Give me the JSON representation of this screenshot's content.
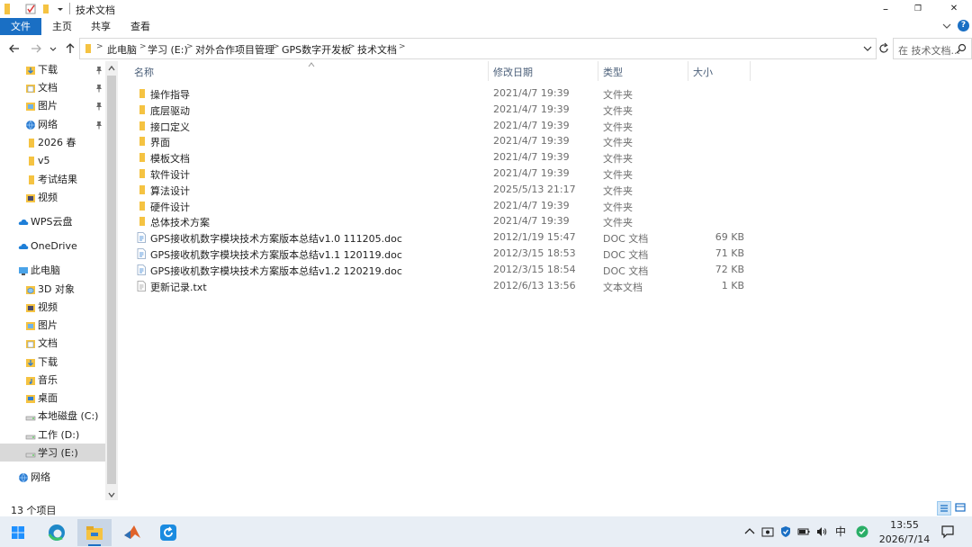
{
  "window": {
    "title": "技术文档",
    "minimize_label": "–",
    "maximize_label": "❐",
    "close_label": "✕"
  },
  "ribbon": {
    "tabs": [
      "文件",
      "主页",
      "共享",
      "查看"
    ],
    "help_label": "?"
  },
  "address": {
    "breadcrumbs": [
      "此电脑",
      "学习 (E:)",
      "对外合作项目管理",
      "GPS数字开发板",
      "技术文档"
    ],
    "search_placeholder": "在 技术文档..."
  },
  "nav": {
    "items": [
      {
        "label": "下载",
        "icon": "download-folder-icon",
        "pinned": true
      },
      {
        "label": "文档",
        "icon": "documents-folder-icon",
        "pinned": true
      },
      {
        "label": "图片",
        "icon": "pictures-folder-icon",
        "pinned": true
      },
      {
        "label": "网络",
        "icon": "network-icon",
        "pinned": true
      },
      {
        "label": "2026 春",
        "icon": "folder-icon",
        "pinned": false
      },
      {
        "label": "v5",
        "icon": "folder-icon",
        "pinned": false
      },
      {
        "label": "考试结果",
        "icon": "folder-icon",
        "pinned": false
      },
      {
        "label": "视频",
        "icon": "videos-folder-icon",
        "pinned": false
      },
      {
        "label": "WPS云盘",
        "icon": "cloud-icon",
        "pinned": false
      },
      {
        "label": "OneDrive",
        "icon": "cloud-icon",
        "pinned": false
      },
      {
        "label": "此电脑",
        "icon": "computer-icon",
        "pinned": false
      },
      {
        "label": "3D 对象",
        "icon": "3d-objects-icon",
        "pinned": false
      },
      {
        "label": "视频",
        "icon": "videos-folder-icon",
        "pinned": false
      },
      {
        "label": "图片",
        "icon": "pictures-folder-icon",
        "pinned": false
      },
      {
        "label": "文档",
        "icon": "documents-folder-icon",
        "pinned": false
      },
      {
        "label": "下载",
        "icon": "download-folder-icon",
        "pinned": false
      },
      {
        "label": "音乐",
        "icon": "music-folder-icon",
        "pinned": false
      },
      {
        "label": "桌面",
        "icon": "desktop-folder-icon",
        "pinned": false
      },
      {
        "label": "本地磁盘 (C:)",
        "icon": "drive-icon",
        "pinned": false
      },
      {
        "label": "工作 (D:)",
        "icon": "drive-icon",
        "pinned": false
      },
      {
        "label": "学习 (E:)",
        "icon": "drive-icon",
        "pinned": false,
        "selected": true
      },
      {
        "label": "网络",
        "icon": "network-icon",
        "pinned": false
      }
    ],
    "pin_glyph": "📌"
  },
  "columns": {
    "name": "名称",
    "date": "修改日期",
    "type": "类型",
    "size": "大小"
  },
  "files": [
    {
      "name": "操作指导",
      "date": "2021/4/7 19:39",
      "type": "文件夹",
      "size": "",
      "icon": "folder-icon"
    },
    {
      "name": "底层驱动",
      "date": "2021/4/7 19:39",
      "type": "文件夹",
      "size": "",
      "icon": "folder-icon"
    },
    {
      "name": "接口定义",
      "date": "2021/4/7 19:39",
      "type": "文件夹",
      "size": "",
      "icon": "folder-icon"
    },
    {
      "name": "界面",
      "date": "2021/4/7 19:39",
      "type": "文件夹",
      "size": "",
      "icon": "folder-icon"
    },
    {
      "name": "模板文档",
      "date": "2021/4/7 19:39",
      "type": "文件夹",
      "size": "",
      "icon": "folder-icon"
    },
    {
      "name": "软件设计",
      "date": "2021/4/7 19:39",
      "type": "文件夹",
      "size": "",
      "icon": "folder-icon"
    },
    {
      "name": "算法设计",
      "date": "2025/5/13 21:17",
      "type": "文件夹",
      "size": "",
      "icon": "folder-icon"
    },
    {
      "name": "硬件设计",
      "date": "2021/4/7 19:39",
      "type": "文件夹",
      "size": "",
      "icon": "folder-icon"
    },
    {
      "name": "总体技术方案",
      "date": "2021/4/7 19:39",
      "type": "文件夹",
      "size": "",
      "icon": "folder-icon"
    },
    {
      "name": "GPS接收机数字模块技术方案版本总结v1.0 111205.doc",
      "date": "2012/1/19 15:47",
      "type": "DOC 文档",
      "size": "69 KB",
      "icon": "doc-file-icon"
    },
    {
      "name": "GPS接收机数字模块技术方案版本总结v1.1 120119.doc",
      "date": "2012/3/15 18:53",
      "type": "DOC 文档",
      "size": "71 KB",
      "icon": "doc-file-icon"
    },
    {
      "name": "GPS接收机数字模块技术方案版本总结v1.2 120219.doc",
      "date": "2012/3/15 18:54",
      "type": "DOC 文档",
      "size": "72 KB",
      "icon": "doc-file-icon"
    },
    {
      "name": "更新记录.txt",
      "date": "2012/6/13 13:56",
      "type": "文本文档",
      "size": "1 KB",
      "icon": "txt-file-icon"
    }
  ],
  "status": {
    "count": "13 个项目"
  },
  "taskbar": {
    "ime": "中",
    "time": "13:55",
    "date": "2026/7/14"
  },
  "colors": {
    "accent": "#1a6fc4",
    "folder": "#f5c342",
    "selection": "#d9d9d9"
  }
}
